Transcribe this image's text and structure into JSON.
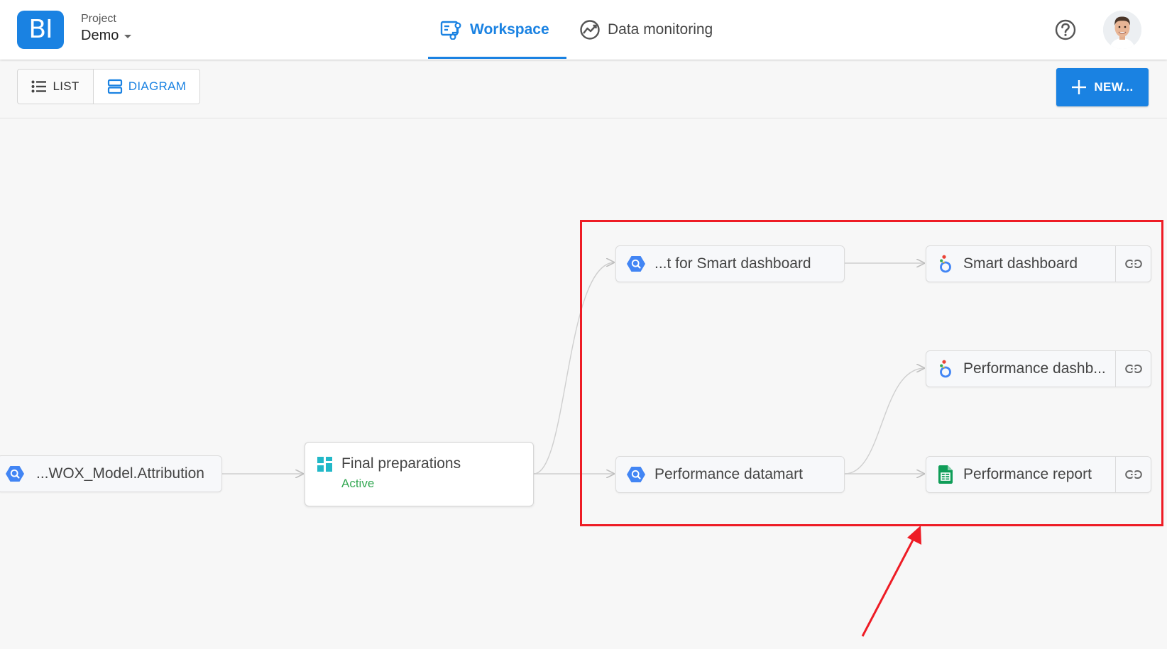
{
  "header": {
    "logo_text": "BI",
    "project_label": "Project",
    "project_value": "Demo",
    "tabs": [
      {
        "label": "Workspace",
        "icon": "workspace-icon",
        "active": true
      },
      {
        "label": "Data monitoring",
        "icon": "monitoring-icon",
        "active": false
      }
    ],
    "help_icon": "help-icon",
    "avatar_icon": "avatar-icon"
  },
  "toolbar": {
    "view_list_label": "LIST",
    "view_diagram_label": "DIAGRAM",
    "active_view": "DIAGRAM",
    "new_label": "NEW..."
  },
  "diagram": {
    "nodes": [
      {
        "id": "attribution",
        "label": "...WOX_Model.Attribution",
        "icon": "bigquery-icon"
      },
      {
        "id": "final-preparations",
        "label": "Final preparations",
        "status": "Active",
        "icon": "pipeline-icon"
      },
      {
        "id": "smart-datamart",
        "label": "...t for Smart dashboard",
        "icon": "bigquery-icon"
      },
      {
        "id": "performance-datamart",
        "label": "Performance datamart",
        "icon": "bigquery-icon"
      },
      {
        "id": "smart-dashboard",
        "label": "Smart dashboard",
        "icon": "looker-studio-icon",
        "link_icon": "link-icon"
      },
      {
        "id": "performance-dashboard",
        "label": "Performance dashb...",
        "icon": "looker-studio-icon",
        "link_icon": "link-icon"
      },
      {
        "id": "performance-report",
        "label": "Performance report",
        "icon": "google-sheets-icon",
        "link_icon": "link-icon"
      }
    ],
    "edges": [
      [
        "attribution",
        "final-preparations"
      ],
      [
        "final-preparations",
        "smart-datamart"
      ],
      [
        "final-preparations",
        "performance-datamart"
      ],
      [
        "smart-datamart",
        "smart-dashboard"
      ],
      [
        "performance-datamart",
        "performance-dashboard"
      ],
      [
        "performance-datamart",
        "performance-report"
      ]
    ]
  },
  "colors": {
    "accent": "#1a82e2",
    "status_active": "#34a853",
    "annotation": "#ee1c25"
  }
}
